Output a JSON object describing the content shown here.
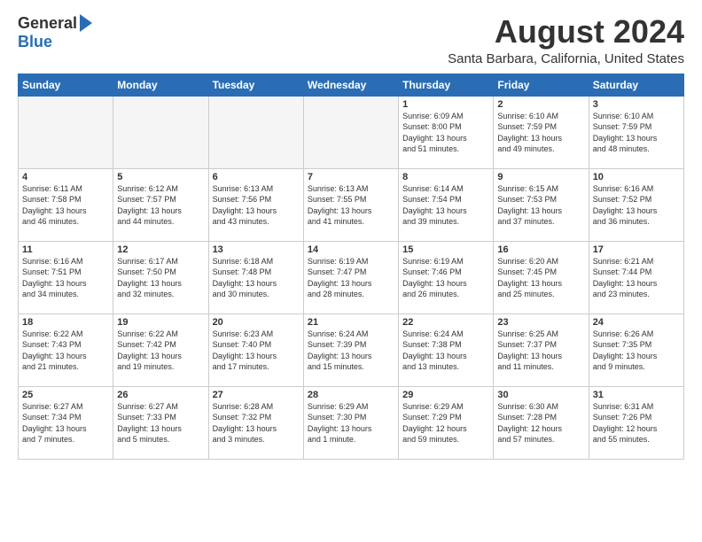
{
  "logo": {
    "general": "General",
    "blue": "Blue"
  },
  "title": "August 2024",
  "subtitle": "Santa Barbara, California, United States",
  "weekdays": [
    "Sunday",
    "Monday",
    "Tuesday",
    "Wednesday",
    "Thursday",
    "Friday",
    "Saturday"
  ],
  "weeks": [
    [
      {
        "num": "",
        "info": ""
      },
      {
        "num": "",
        "info": ""
      },
      {
        "num": "",
        "info": ""
      },
      {
        "num": "",
        "info": ""
      },
      {
        "num": "1",
        "info": "Sunrise: 6:09 AM\nSunset: 8:00 PM\nDaylight: 13 hours\nand 51 minutes."
      },
      {
        "num": "2",
        "info": "Sunrise: 6:10 AM\nSunset: 7:59 PM\nDaylight: 13 hours\nand 49 minutes."
      },
      {
        "num": "3",
        "info": "Sunrise: 6:10 AM\nSunset: 7:59 PM\nDaylight: 13 hours\nand 48 minutes."
      }
    ],
    [
      {
        "num": "4",
        "info": "Sunrise: 6:11 AM\nSunset: 7:58 PM\nDaylight: 13 hours\nand 46 minutes."
      },
      {
        "num": "5",
        "info": "Sunrise: 6:12 AM\nSunset: 7:57 PM\nDaylight: 13 hours\nand 44 minutes."
      },
      {
        "num": "6",
        "info": "Sunrise: 6:13 AM\nSunset: 7:56 PM\nDaylight: 13 hours\nand 43 minutes."
      },
      {
        "num": "7",
        "info": "Sunrise: 6:13 AM\nSunset: 7:55 PM\nDaylight: 13 hours\nand 41 minutes."
      },
      {
        "num": "8",
        "info": "Sunrise: 6:14 AM\nSunset: 7:54 PM\nDaylight: 13 hours\nand 39 minutes."
      },
      {
        "num": "9",
        "info": "Sunrise: 6:15 AM\nSunset: 7:53 PM\nDaylight: 13 hours\nand 37 minutes."
      },
      {
        "num": "10",
        "info": "Sunrise: 6:16 AM\nSunset: 7:52 PM\nDaylight: 13 hours\nand 36 minutes."
      }
    ],
    [
      {
        "num": "11",
        "info": "Sunrise: 6:16 AM\nSunset: 7:51 PM\nDaylight: 13 hours\nand 34 minutes."
      },
      {
        "num": "12",
        "info": "Sunrise: 6:17 AM\nSunset: 7:50 PM\nDaylight: 13 hours\nand 32 minutes."
      },
      {
        "num": "13",
        "info": "Sunrise: 6:18 AM\nSunset: 7:48 PM\nDaylight: 13 hours\nand 30 minutes."
      },
      {
        "num": "14",
        "info": "Sunrise: 6:19 AM\nSunset: 7:47 PM\nDaylight: 13 hours\nand 28 minutes."
      },
      {
        "num": "15",
        "info": "Sunrise: 6:19 AM\nSunset: 7:46 PM\nDaylight: 13 hours\nand 26 minutes."
      },
      {
        "num": "16",
        "info": "Sunrise: 6:20 AM\nSunset: 7:45 PM\nDaylight: 13 hours\nand 25 minutes."
      },
      {
        "num": "17",
        "info": "Sunrise: 6:21 AM\nSunset: 7:44 PM\nDaylight: 13 hours\nand 23 minutes."
      }
    ],
    [
      {
        "num": "18",
        "info": "Sunrise: 6:22 AM\nSunset: 7:43 PM\nDaylight: 13 hours\nand 21 minutes."
      },
      {
        "num": "19",
        "info": "Sunrise: 6:22 AM\nSunset: 7:42 PM\nDaylight: 13 hours\nand 19 minutes."
      },
      {
        "num": "20",
        "info": "Sunrise: 6:23 AM\nSunset: 7:40 PM\nDaylight: 13 hours\nand 17 minutes."
      },
      {
        "num": "21",
        "info": "Sunrise: 6:24 AM\nSunset: 7:39 PM\nDaylight: 13 hours\nand 15 minutes."
      },
      {
        "num": "22",
        "info": "Sunrise: 6:24 AM\nSunset: 7:38 PM\nDaylight: 13 hours\nand 13 minutes."
      },
      {
        "num": "23",
        "info": "Sunrise: 6:25 AM\nSunset: 7:37 PM\nDaylight: 13 hours\nand 11 minutes."
      },
      {
        "num": "24",
        "info": "Sunrise: 6:26 AM\nSunset: 7:35 PM\nDaylight: 13 hours\nand 9 minutes."
      }
    ],
    [
      {
        "num": "25",
        "info": "Sunrise: 6:27 AM\nSunset: 7:34 PM\nDaylight: 13 hours\nand 7 minutes."
      },
      {
        "num": "26",
        "info": "Sunrise: 6:27 AM\nSunset: 7:33 PM\nDaylight: 13 hours\nand 5 minutes."
      },
      {
        "num": "27",
        "info": "Sunrise: 6:28 AM\nSunset: 7:32 PM\nDaylight: 13 hours\nand 3 minutes."
      },
      {
        "num": "28",
        "info": "Sunrise: 6:29 AM\nSunset: 7:30 PM\nDaylight: 13 hours\nand 1 minute."
      },
      {
        "num": "29",
        "info": "Sunrise: 6:29 AM\nSunset: 7:29 PM\nDaylight: 12 hours\nand 59 minutes."
      },
      {
        "num": "30",
        "info": "Sunrise: 6:30 AM\nSunset: 7:28 PM\nDaylight: 12 hours\nand 57 minutes."
      },
      {
        "num": "31",
        "info": "Sunrise: 6:31 AM\nSunset: 7:26 PM\nDaylight: 12 hours\nand 55 minutes."
      }
    ]
  ]
}
